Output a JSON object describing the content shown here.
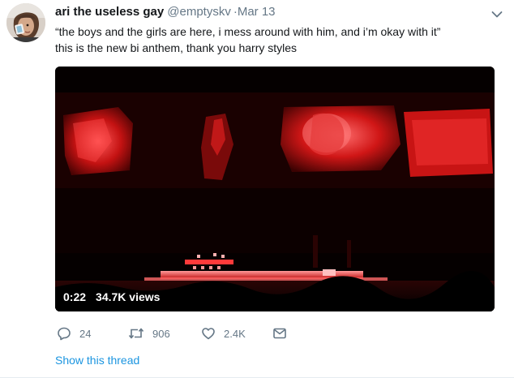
{
  "tweet": {
    "display_name": "ari the useless gay",
    "handle": "@emptyskv",
    "separator": "·",
    "timestamp": "Mar 13",
    "text_line_1": "“the boys and the girls are here, i mess around with him, and i’m okay with it”",
    "text_line_2": "this is the new bi anthem, thank you harry styles",
    "media": {
      "duration": "0:22",
      "views": "34.7K views"
    },
    "actions": {
      "reply_count": "24",
      "retweet_count": "906",
      "like_count": "2.4K"
    },
    "show_thread_label": "Show this thread"
  },
  "colors": {
    "text": "#14171a",
    "secondary": "#657786",
    "link": "#1b95e0",
    "video_red": "#d11818"
  },
  "icons": [
    "avatar-photo",
    "caret-down-icon",
    "reply-icon",
    "retweet-icon",
    "heart-icon",
    "direct-message-icon"
  ]
}
